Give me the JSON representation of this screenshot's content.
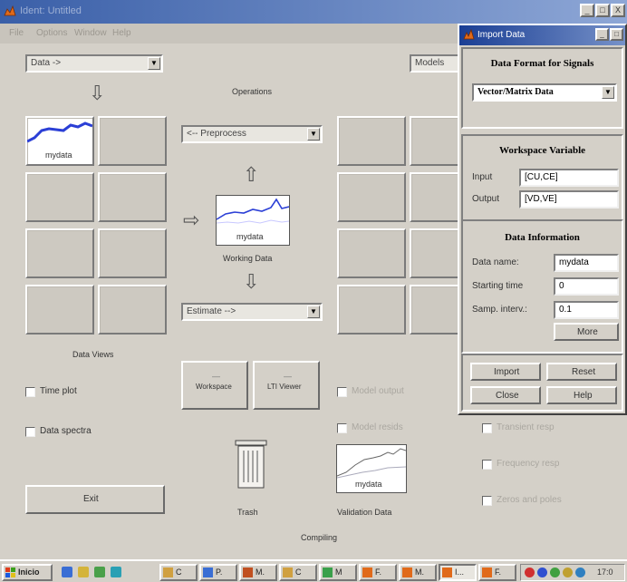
{
  "main_window": {
    "title": "Ident: Untitled",
    "menu": [
      "File",
      "Options",
      "Window",
      "Help"
    ],
    "window_controls": [
      "_",
      "□",
      "X"
    ]
  },
  "import_dropdown": "Data ->",
  "models_dropdown": "Models",
  "operations": {
    "label": "Operations",
    "preprocess_dropdown": "<-- Preprocess",
    "estimate_dropdown": "Estimate -->"
  },
  "working_data": {
    "plot_label": "mydata",
    "caption": "Working Data"
  },
  "data_board": {
    "first_item_label": "mydata",
    "caption": "Data Views"
  },
  "checkboxes_left": [
    {
      "label": "Time plot",
      "checked": false
    },
    {
      "label": "Data spectra",
      "checked": false
    }
  ],
  "tool_buttons": [
    {
      "label": "Workspace"
    },
    {
      "label": "LTI Viewer"
    }
  ],
  "exit_button": "Exit",
  "trash_label": "Trash",
  "validation": {
    "plot_label": "mydata",
    "caption": "Validation Data"
  },
  "compiling_label": "Compiling",
  "model_checkboxes": [
    {
      "label": "Model output"
    },
    {
      "label": "Model resids"
    },
    {
      "label": "Transient resp"
    },
    {
      "label": "Frequency resp"
    },
    {
      "label": "Zeros and poles"
    }
  ],
  "import_dialog": {
    "title": "Import Data",
    "format_title": "Data Format for Signals",
    "format_value": "Vector/Matrix Data",
    "workspace_title": "Workspace Variable",
    "input_label": "Input",
    "input_value": "[CU,CE]",
    "output_label": "Output",
    "output_value": "[VD,VE]",
    "info_title": "Data Information",
    "data_name_label": "Data name:",
    "data_name_value": "mydata",
    "start_time_label": "Starting time",
    "start_time_value": "0",
    "samp_interv_label": "Samp. interv.:",
    "samp_interv_value": "0.1",
    "more_button": "More",
    "import_button": "Import",
    "reset_button": "Reset",
    "close_button": "Close",
    "help_button": "Help"
  },
  "taskbar": {
    "start_label": "Inicio",
    "items": [
      "C",
      "P.",
      "M.",
      "C",
      "M",
      "F.",
      "M.",
      "I...",
      "F."
    ],
    "clock": "17:0"
  },
  "colors": {
    "title_bar": "#3a5fa8",
    "dialog_title": "#1a3e94",
    "signal_blue": "#2b3fd6",
    "window_bg": "#d4d0c8"
  }
}
